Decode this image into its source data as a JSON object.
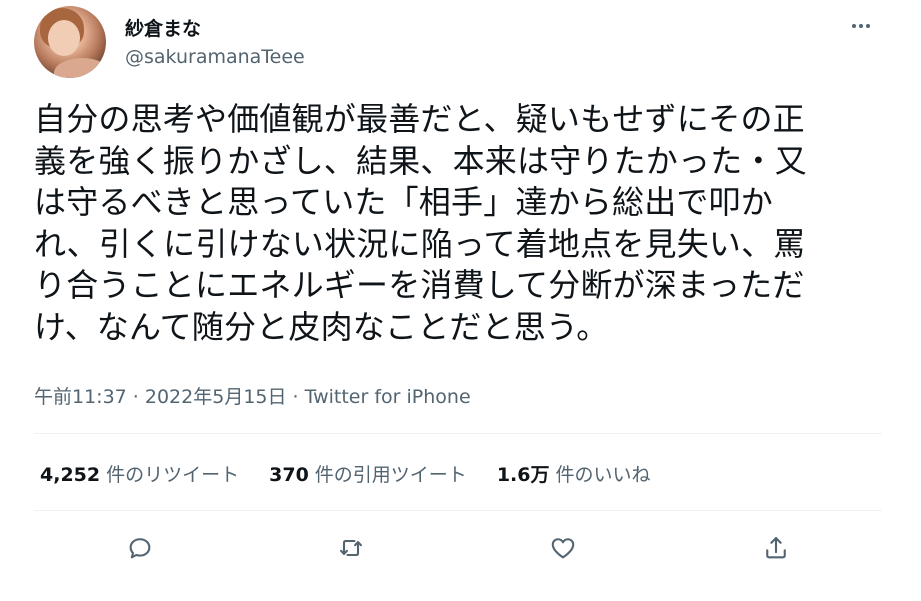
{
  "user": {
    "display_name": "紗倉まな",
    "handle": "@sakuramanaTeee"
  },
  "tweet": {
    "lines": [
      "自分の思考や価値観が最善だと、疑いもせずにその正",
      "義を強く振りかざし、結果、本来は守りたかった・又",
      "は守るべきと思っていた「相手」達から総出で叩か",
      "れ、引くに引けない状況に陥って着地点を見失い、罵",
      "り合うことにエネルギーを消費して分断が深まっただ",
      "け、なんて随分と皮肉なことだと思う。"
    ],
    "timestamp": "午前11:37 · 2022年5月15日 · ",
    "source": "Twitter for iPhone"
  },
  "stats": {
    "retweets": {
      "count": "4,252",
      "label": "件のリツイート"
    },
    "quotes": {
      "count": "370",
      "label": "件の引用ツイート"
    },
    "likes": {
      "count": "1.6万",
      "label": "件のいいね"
    }
  },
  "icons": {
    "more": "more-icon",
    "reply": "reply-icon",
    "retweet": "retweet-icon",
    "like": "like-icon",
    "share": "share-icon"
  },
  "colors": {
    "text": "#0f1419",
    "secondary": "#536471",
    "divider": "#eff3f4"
  }
}
